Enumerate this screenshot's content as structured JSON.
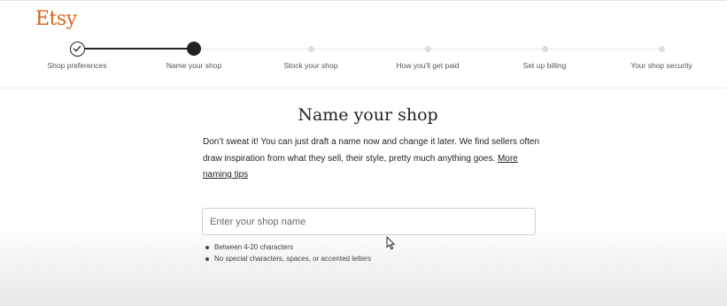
{
  "brand": {
    "logo_text": "Etsy",
    "color": "#d5641c"
  },
  "stepper": {
    "steps": [
      {
        "label": "Shop preferences",
        "state": "completed",
        "icon": "check-icon"
      },
      {
        "label": "Name your shop",
        "state": "current"
      },
      {
        "label": "Stock your shop",
        "state": "upcoming"
      },
      {
        "label": "How you'll get paid",
        "state": "upcoming"
      },
      {
        "label": "Set up billing",
        "state": "upcoming"
      },
      {
        "label": "Your shop security",
        "state": "upcoming"
      }
    ]
  },
  "main": {
    "title": "Name your shop",
    "description": "Don’t sweat it! You can just draft a name now and change it later. We find sellers often draw inspiration from what they sell, their style, pretty much anything goes.",
    "tips_link": "More naming tips",
    "shop_name_input": {
      "placeholder": "Enter your shop name",
      "value": ""
    },
    "requirements": [
      "Between 4-20 characters",
      "No special characters, spaces, or accented letters"
    ]
  },
  "cursor": {
    "icon": "mouse-pointer-icon"
  }
}
